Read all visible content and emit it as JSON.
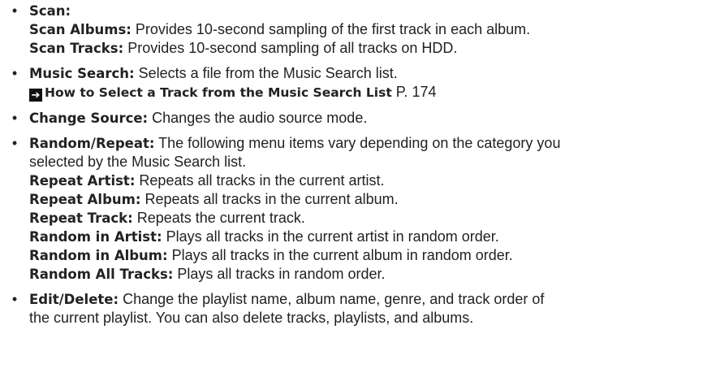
{
  "items": [
    {
      "term": "Scan:",
      "sub": [
        {
          "term": "Scan Albums:",
          "text": " Provides 10-second sampling of the first track in each album."
        },
        {
          "term": "Scan Tracks:",
          "text": " Provides 10-second sampling of all tracks on HDD."
        }
      ]
    },
    {
      "term": "Music Search:",
      "text": " Selects a file from the Music Search list.",
      "ref": {
        "title": "How to Select a Track from the Music Search List",
        "page": " P. 174"
      }
    },
    {
      "term": "Change Source:",
      "text": " Changes the audio source mode."
    },
    {
      "term": "Random/Repeat:",
      "text_line1": " The following menu items vary depending on the category you",
      "text_line2": "selected by the Music Search list.",
      "sub": [
        {
          "term": "Repeat Artist:",
          "text": " Repeats all tracks in the current artist."
        },
        {
          "term": "Repeat Album:",
          "text": " Repeats all tracks in the current album."
        },
        {
          "term": "Repeat Track:",
          "text": " Repeats the current track."
        },
        {
          "term": "Random in Artist:",
          "text": " Plays all tracks in the current artist in random order."
        },
        {
          "term": "Random in Album:",
          "text": " Plays all tracks in the current album in random order."
        },
        {
          "term": "Random All Tracks:",
          "text": " Plays all tracks in random order."
        }
      ]
    },
    {
      "term": "Edit/Delete:",
      "text_line1": " Change the playlist name, album name, genre, and track order of",
      "text_line2": "the current playlist. You can also delete tracks, playlists, and albums."
    }
  ],
  "bullet_char": "•",
  "ref_arrow_char": "➔"
}
